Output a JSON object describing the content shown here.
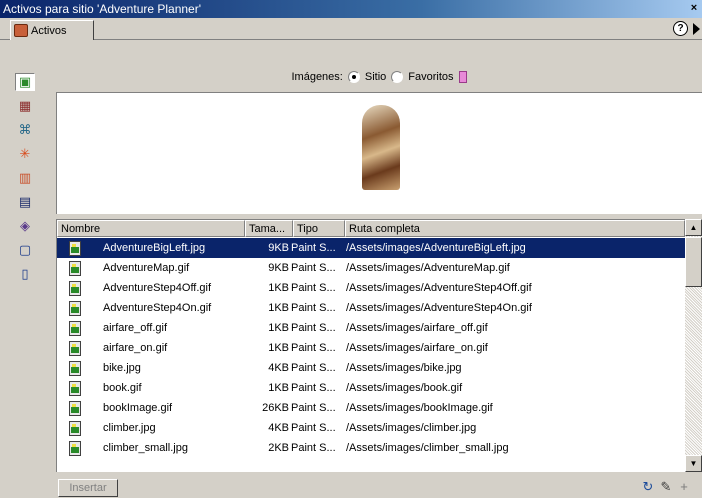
{
  "window": {
    "title": "Activos para sitio 'Adventure Planner'",
    "close_glyph": "×"
  },
  "tab": {
    "label": "Activos"
  },
  "header": {
    "help_glyph": "?"
  },
  "filter": {
    "label": "Imágenes:",
    "options": [
      {
        "label": "Sitio",
        "selected": true
      },
      {
        "label": "Favoritos",
        "selected": false
      }
    ]
  },
  "toolbar_icons": [
    "images-icon",
    "colors-icon",
    "urls-icon",
    "flash-icon",
    "shockwave-icon",
    "movies-icon",
    "scripts-icon",
    "templates-icon",
    "library-icon"
  ],
  "table": {
    "columns": [
      "Nombre",
      "Tama...",
      "Tipo",
      "Ruta completa"
    ],
    "rows": [
      {
        "name": "AdventureBigLeft.jpg",
        "size": "9KB",
        "type": "Paint S...",
        "path": "/Assets/images/AdventureBigLeft.jpg",
        "selected": true
      },
      {
        "name": "AdventureMap.gif",
        "size": "9KB",
        "type": "Paint S...",
        "path": "/Assets/images/AdventureMap.gif"
      },
      {
        "name": "AdventureStep4Off.gif",
        "size": "1KB",
        "type": "Paint S...",
        "path": "/Assets/images/AdventureStep4Off.gif"
      },
      {
        "name": "AdventureStep4On.gif",
        "size": "1KB",
        "type": "Paint S...",
        "path": "/Assets/images/AdventureStep4On.gif"
      },
      {
        "name": "airfare_off.gif",
        "size": "1KB",
        "type": "Paint S...",
        "path": "/Assets/images/airfare_off.gif"
      },
      {
        "name": "airfare_on.gif",
        "size": "1KB",
        "type": "Paint S...",
        "path": "/Assets/images/airfare_on.gif"
      },
      {
        "name": "bike.jpg",
        "size": "4KB",
        "type": "Paint S...",
        "path": "/Assets/images/bike.jpg"
      },
      {
        "name": "book.gif",
        "size": "1KB",
        "type": "Paint S...",
        "path": "/Assets/images/book.gif"
      },
      {
        "name": "bookImage.gif",
        "size": "26KB",
        "type": "Paint S...",
        "path": "/Assets/images/bookImage.gif"
      },
      {
        "name": "climber.jpg",
        "size": "4KB",
        "type": "Paint S...",
        "path": "/Assets/images/climber.jpg"
      },
      {
        "name": "climber_small.jpg",
        "size": "2KB",
        "type": "Paint S...",
        "path": "/Assets/images/climber_small.jpg"
      }
    ]
  },
  "footer": {
    "insert_label": "Insertar"
  },
  "colors": {
    "titlebar": "#0a246a",
    "selection": "#0a246a",
    "chrome": "#d4d0c8"
  }
}
